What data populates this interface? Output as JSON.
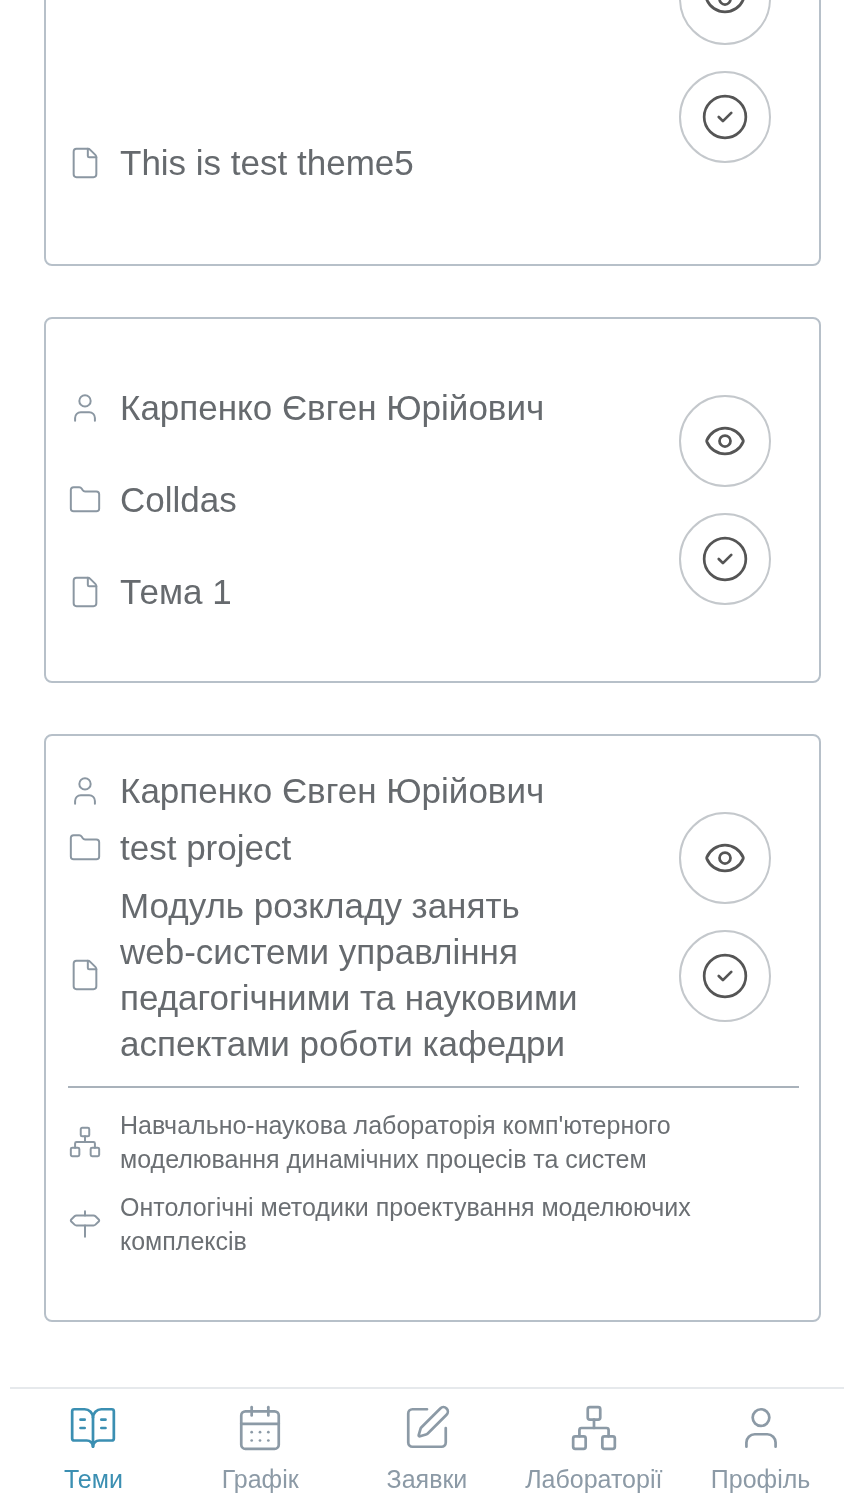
{
  "cards": [
    {
      "rows": [
        {
          "kind": "theme",
          "text": "This is test theme5"
        }
      ]
    },
    {
      "rows": [
        {
          "kind": "person",
          "text": "Карпенко Євген Юрійович"
        },
        {
          "kind": "project",
          "text": "Colldas"
        },
        {
          "kind": "theme",
          "text": "Тема 1"
        }
      ]
    },
    {
      "rows": [
        {
          "kind": "person",
          "text": "Карпенко Євген Юрійович"
        },
        {
          "kind": "project",
          "text": "test project"
        },
        {
          "kind": "theme",
          "text": "Модуль розкладу занять web-системи управління педагогічними та науковими аспектами роботи кафедри"
        }
      ],
      "details": [
        {
          "kind": "laboratory",
          "text": "Навчально-наукова лабораторія комп'ютерного моделювання динамічних процесів та систем"
        },
        {
          "kind": "direction",
          "text": "Онтологічні методики проектування моделюючих комплексів"
        }
      ]
    }
  ],
  "nav": [
    {
      "kind": "themes",
      "label": "Теми",
      "selected": true
    },
    {
      "kind": "schedule",
      "label": "Графік",
      "selected": false
    },
    {
      "kind": "requests",
      "label": "Заявки",
      "selected": false
    },
    {
      "kind": "labs",
      "label": "Лабораторії",
      "selected": false
    },
    {
      "kind": "profile",
      "label": "Профіль",
      "selected": false
    }
  ]
}
